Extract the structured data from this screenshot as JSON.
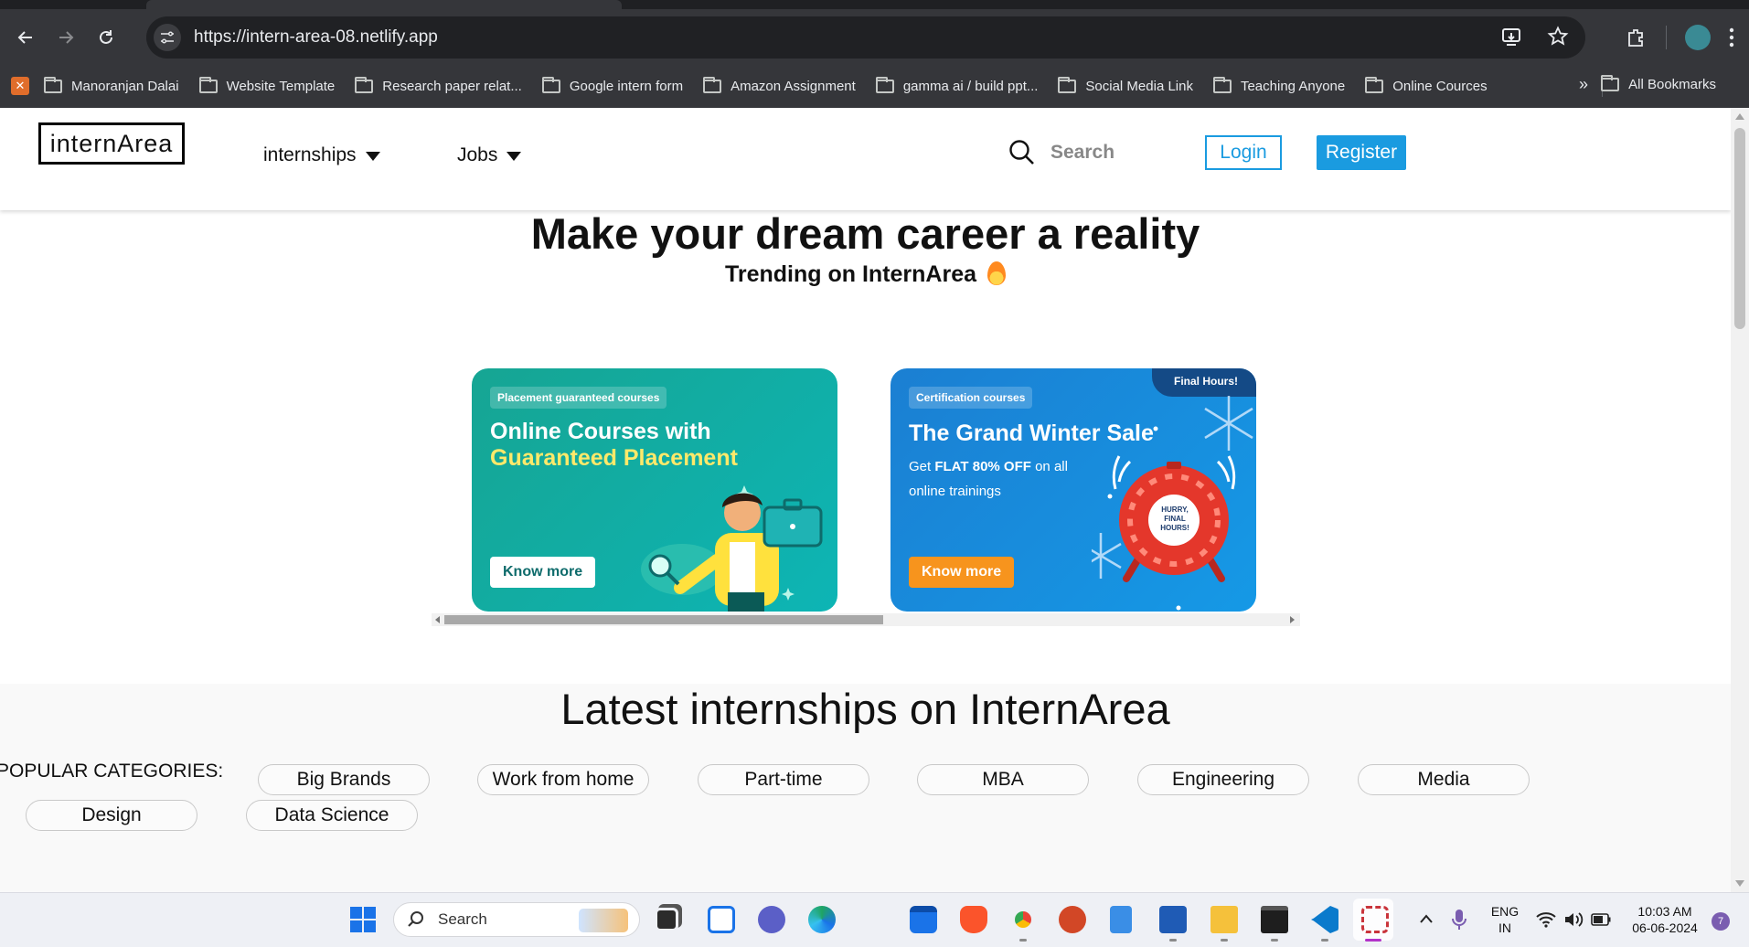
{
  "browser": {
    "url": "https://intern-area-08.netlify.app",
    "bookmarks": [
      "Manoranjan Dalai",
      "Website Template",
      "Research paper relat...",
      "Google intern form",
      "Amazon Assignment",
      "gamma ai / build ppt...",
      "Social Media Link",
      "Teaching  Anyone",
      "Online Cources"
    ],
    "all_bookmarks": "All Bookmarks",
    "more": "»"
  },
  "site": {
    "logo": "internArea",
    "nav": {
      "internships": "internships",
      "jobs": "Jobs",
      "search_placeholder": "Search",
      "login": "Login",
      "register": "Register"
    },
    "hero": {
      "title": "Make your dream career a reality",
      "subtitle": "Trending on InternArea"
    },
    "cards": [
      {
        "tag": "Placement guaranteed courses",
        "title_line1": "Online Courses with",
        "title_line2": "Guaranteed Placement",
        "button": "Know more"
      },
      {
        "tag": "Certification courses",
        "ribbon": "Final Hours!",
        "title": "The Grand Winter Sale",
        "desc_pre": "Get ",
        "desc_bold": "FLAT 80% OFF",
        "desc_post": " on all online trainings",
        "clock_text": "HURRY, FINAL HOURS!",
        "button": "Know more"
      }
    ],
    "latest": {
      "title": "Latest internships on InternArea",
      "categories_label": "POPULAR CATEGORIES:",
      "categories": [
        "Big Brands",
        "Work from home",
        "Part-time",
        "MBA",
        "Engineering",
        "Media",
        "Design",
        "Data Science"
      ]
    }
  },
  "taskbar": {
    "search": "Search",
    "language_line1": "ENG",
    "language_line2": "IN",
    "time": "10:03 AM",
    "date": "06-06-2024",
    "notification_count": "7"
  },
  "colors": {
    "brand_blue": "#1a9be0",
    "card1_bg": "#16a593",
    "card2_bg": "#1b7fd2",
    "accent_yellow": "#ffe96a",
    "orange_button": "#f7941d"
  }
}
